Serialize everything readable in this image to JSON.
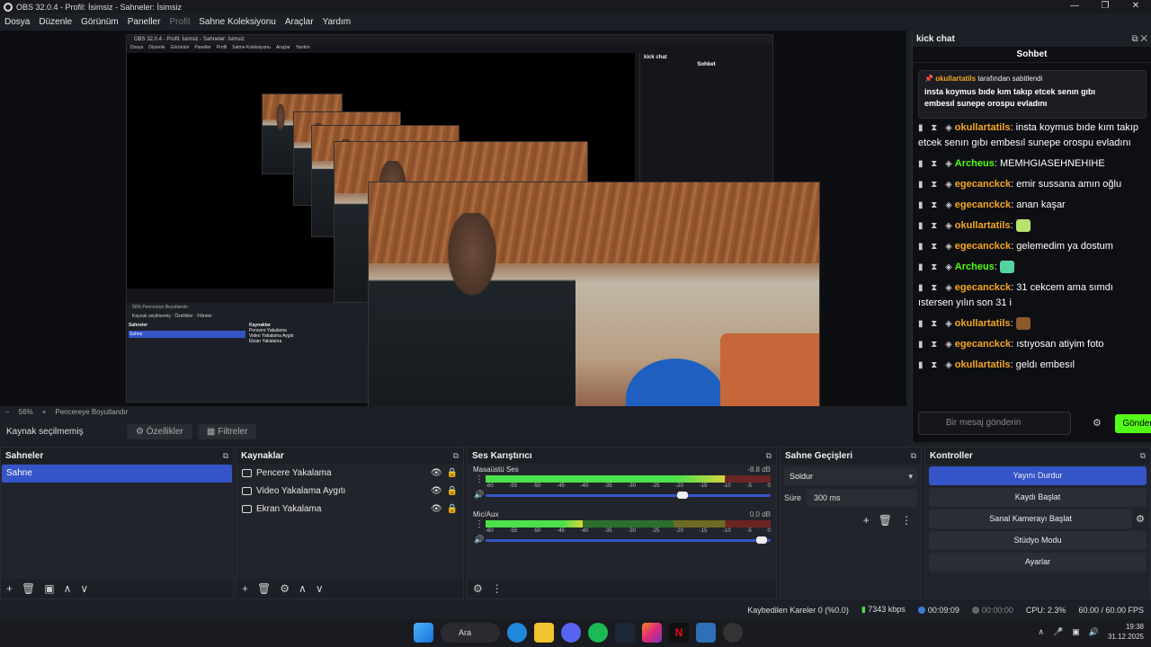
{
  "window": {
    "title": "OBS 32.0.4 - Profil: İsimsiz - Sahneler: İsimsiz",
    "controls": [
      "—",
      "❐",
      "✕"
    ]
  },
  "menu": [
    "Dosya",
    "Düzenle",
    "Görünüm",
    "Paneller",
    "Profil",
    "Sahne Koleksiyonu",
    "Araçlar",
    "Yardım"
  ],
  "nested": {
    "title": "OBS 32.0.4 - Profil: İsimsiz - Sahneler: İsimsiz",
    "menu": [
      "Dosya",
      "Düzenle",
      "Görünüm",
      "Paneller",
      "Profil",
      "Sahne Koleksiyonu",
      "Araçlar",
      "Yardım"
    ],
    "chat_title": "kick chat",
    "chat_sub": "Sohbet",
    "zoom": "56%",
    "fit": "Pencereye Boyutlandır",
    "no_source": "Kaynak seçilmemiş",
    "props": "Özellikler",
    "filters": "Filtreler",
    "scenes_h": "Sahneler",
    "sources_h": "Kaynaklar",
    "scene": "Sahne",
    "sources": [
      "Pencere Yakalama",
      "Video Yakalama Aygıtı",
      "Ekran Yakalama"
    ]
  },
  "preview_bar": {
    "zoom": "56%",
    "fit": "Pencereye Boyutlandır"
  },
  "source_bar": {
    "label": "Kaynak seçilmemiş",
    "properties": "Özellikler",
    "filters": "Filtreler"
  },
  "scenes": {
    "title": "Sahneler",
    "items": [
      "Sahne"
    ]
  },
  "sources": {
    "title": "Kaynaklar",
    "items": [
      "Pencere Yakalama",
      "Video Yakalama Aygıtı",
      "Ekran Yakalama"
    ]
  },
  "mixer": {
    "title": "Ses Karıştırıcı",
    "scale": [
      "-60",
      "-55",
      "-50",
      "-45",
      "-40",
      "-35",
      "-30",
      "-25",
      "-20",
      "-15",
      "-10",
      "-5",
      "0"
    ],
    "tracks": [
      {
        "name": "Masaüstü Ses",
        "db": "-8.8 dB",
        "level": 0.84,
        "volume": 0.69
      },
      {
        "name": "Mic/Aux",
        "db": "0.0 dB",
        "level": 0.34,
        "volume": 0.97
      }
    ]
  },
  "transitions": {
    "title": "Sahne Geçişleri",
    "selected": "Soldur",
    "duration_label": "Süre",
    "duration": "300 ms"
  },
  "controls": {
    "title": "Kontroller",
    "buttons": [
      "Yayını Durdur",
      "Kaydı Başlat",
      "Sanal Kamerayı Başlat",
      "Stüdyo Modu",
      "Ayarlar"
    ]
  },
  "chat": {
    "title": "kick chat",
    "subtitle": "Sohbet",
    "pinned_header": "tarafından sabitlendi",
    "pinned_user": "okullartatils",
    "pinned_text": "insta koymus bıde kım takıp etcek senın gıbı embesıl sunepe orospu evladını",
    "messages": [
      {
        "user": "okullartatils",
        "text": "insta koymus bıde kım takıp etcek senın gıbı embesıl sunepe orospu evladını",
        "color": "#f5a623"
      },
      {
        "user": "Archeus",
        "text": "MEMHGIASEHNEHIHE",
        "color": "#53fc18"
      },
      {
        "user": "egecanckck",
        "text": "emir sussana amın oğlu",
        "color": "#f5a623"
      },
      {
        "user": "egecanckck",
        "text": "anan kaşar",
        "color": "#f5a623"
      },
      {
        "user": "okullartatils",
        "text": "",
        "color": "#f5a623",
        "emote": "#b9e26b"
      },
      {
        "user": "egecanckck",
        "text": "gelemedim ya dostum",
        "color": "#f5a623"
      },
      {
        "user": "Archeus",
        "text": "",
        "color": "#53fc18",
        "emote": "#53d3a0"
      },
      {
        "user": "egecanckck",
        "text": "31 cekcem ama sımdı ıstersen yılın son 31 i",
        "color": "#f5a623"
      },
      {
        "user": "okullartatils",
        "text": "",
        "color": "#f5a623",
        "emote": "#8a5a2b"
      },
      {
        "user": "egecanckck",
        "text": "ıstıyosan atiyim foto",
        "color": "#f5a623"
      },
      {
        "user": "okullartatils",
        "text": "geldı embesıl",
        "color": "#f5a623"
      }
    ],
    "input_placeholder": "Bir mesaj gönderin",
    "send": "Gönder"
  },
  "status": {
    "dropped": "Kaybedilen Kareler 0 (%0.0)",
    "bitrate": "7343 kbps",
    "stream_time": "00:09:09",
    "rec_time": "00:00:00",
    "cpu": "CPU: 2.3%",
    "fps": "60.00 / 60.00 FPS"
  },
  "taskbar": {
    "search": "Ara",
    "time": "19:38",
    "date": "31.12.2025"
  }
}
